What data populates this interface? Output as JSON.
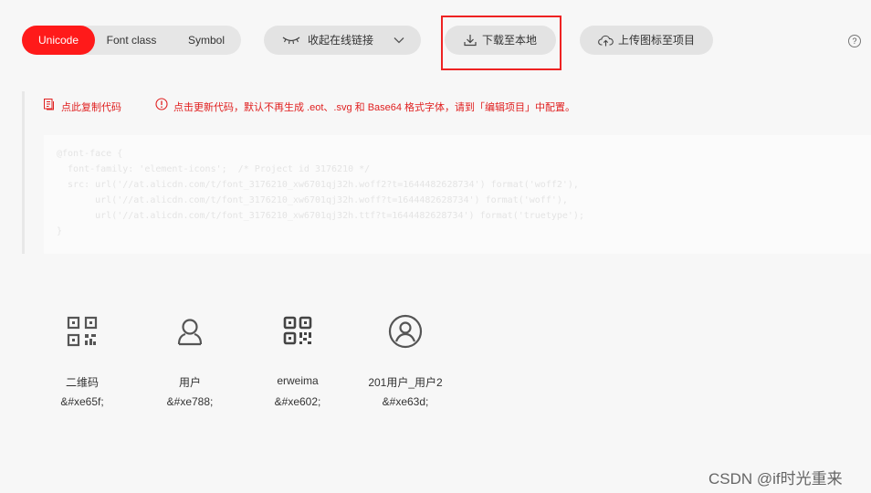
{
  "tabs": [
    {
      "label": "Unicode",
      "active": true
    },
    {
      "label": "Font class",
      "active": false
    },
    {
      "label": "Symbol",
      "active": false
    }
  ],
  "toolbar": {
    "collapse_label": "收起在线链接",
    "download_label": "下载至本地",
    "upload_label": "上传图标至项目",
    "help_label": "?"
  },
  "notice": {
    "copy_label": "点此复制代码",
    "update_text": "点击更新代码，默认不再生成 .eot、.svg 和 Base64 格式字体，请到「编辑项目」中配置。"
  },
  "code_lines": [
    "@font-face {",
    "  font-family: 'element-icons';  /* Project id 3176210 */",
    "  src: url('//at.alicdn.com/t/font_3176210_xw6701qj32h.woff2?t=1644482628734') format('woff2'),",
    "       url('//at.alicdn.com/t/font_3176210_xw6701qj32h.woff?t=1644482628734') format('woff'),",
    "       url('//at.alicdn.com/t/font_3176210_xw6701qj32h.ttf?t=1644482628734') format('truetype');",
    "}"
  ],
  "icons": [
    {
      "name": "二维码",
      "code": "&#xe65f;",
      "icon": "qrcode-icon"
    },
    {
      "name": "用户",
      "code": "&#xe788;",
      "icon": "user-icon"
    },
    {
      "name": "erweima",
      "code": "&#xe602;",
      "icon": "qrcode-alt-icon"
    },
    {
      "name": "201用户_用户2",
      "code": "&#xe63d;",
      "icon": "user-circle-icon"
    }
  ],
  "watermark": "CSDN @if时光重来",
  "colors": {
    "accent": "#ff1a1a",
    "notice": "#e02020",
    "highlight_box": "#e22222"
  }
}
